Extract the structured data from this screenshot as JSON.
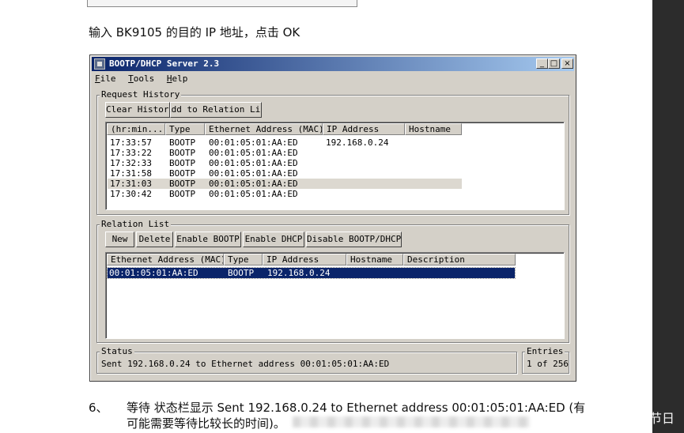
{
  "doc": {
    "instruction": "输入 BK9105 的目的 IP 地址，点击 OK",
    "step_number": "6、",
    "step_line1": "等待 状态栏显示 Sent 192.168.0.24 to Ethernet address 00:01:05:01:AA:ED (有",
    "step_line2": "可能需要等待比较长的时间)。",
    "watermark": "CSDN @光怪陆离的节日"
  },
  "window": {
    "title": "BOOTP/DHCP Server 2.3",
    "minimize": "_",
    "maximize": "□",
    "close": "×"
  },
  "menu": [
    {
      "key": "F",
      "rest": "ile"
    },
    {
      "key": "T",
      "rest": "ools"
    },
    {
      "key": "H",
      "rest": "elp"
    }
  ],
  "request_history": {
    "label": "Request History",
    "clear_button": "Clear History",
    "add_button": "Add to Relation List",
    "columns": [
      "(hr:min...",
      "Type",
      "Ethernet Address (MAC)",
      "IP Address",
      "Hostname"
    ],
    "rows": [
      {
        "time": "17:33:57",
        "type": "BOOTP",
        "mac": "00:01:05:01:AA:ED",
        "ip": "192.168.0.24",
        "host": ""
      },
      {
        "time": "17:33:22",
        "type": "BOOTP",
        "mac": "00:01:05:01:AA:ED",
        "ip": "",
        "host": ""
      },
      {
        "time": "17:32:33",
        "type": "BOOTP",
        "mac": "00:01:05:01:AA:ED",
        "ip": "",
        "host": ""
      },
      {
        "time": "17:31:58",
        "type": "BOOTP",
        "mac": "00:01:05:01:AA:ED",
        "ip": "",
        "host": ""
      },
      {
        "time": "17:31:03",
        "type": "BOOTP",
        "mac": "00:01:05:01:AA:ED",
        "ip": "",
        "host": ""
      },
      {
        "time": "17:30:42",
        "type": "BOOTP",
        "mac": "00:01:05:01:AA:ED",
        "ip": "",
        "host": ""
      }
    ]
  },
  "relation_list": {
    "label": "Relation List",
    "buttons": [
      "New",
      "Delete",
      "Enable BOOTP",
      "Enable DHCP",
      "Disable BOOTP/DHCP"
    ],
    "columns": [
      "Ethernet Address (MAC)",
      "Type",
      "IP Address",
      "Hostname",
      "Description"
    ],
    "rows": [
      {
        "mac": "00:01:05:01:AA:ED",
        "type": "BOOTP",
        "ip": "192.168.0.24",
        "host": "",
        "desc": ""
      }
    ]
  },
  "status": {
    "label": "Status",
    "text": "Sent 192.168.0.24 to Ethernet address 00:01:05:01:AA:ED",
    "entries_label": "Entries",
    "entries_value": "1 of 256"
  }
}
